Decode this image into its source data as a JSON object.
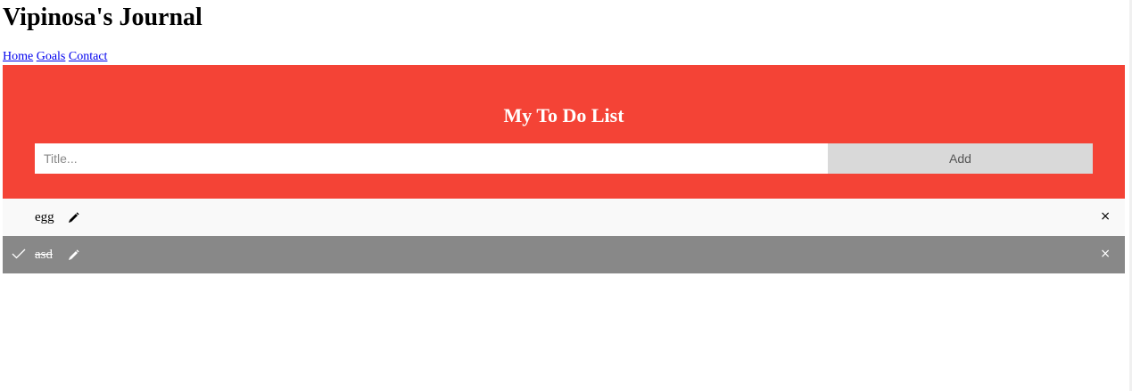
{
  "site": {
    "title": "Vipinosa's Journal"
  },
  "nav": {
    "items": [
      "Home",
      "Goals",
      "Contact"
    ]
  },
  "todo": {
    "heading": "My To Do List",
    "input_placeholder": "Title...",
    "input_value": "",
    "add_label": "Add",
    "accent_color": "#f44336",
    "items": [
      {
        "text": "egg",
        "checked": false,
        "edit_icon": "pencil-icon",
        "close_label": "×"
      },
      {
        "text": "asd",
        "checked": true,
        "check_icon": "checkmark-icon",
        "edit_icon": "pencil-icon",
        "close_label": "×"
      }
    ]
  }
}
